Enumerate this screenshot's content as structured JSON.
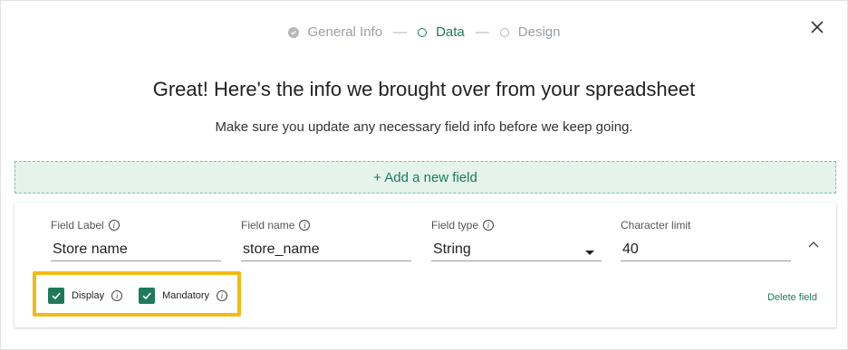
{
  "stepper": {
    "steps": [
      {
        "label": "General Info",
        "state": "done"
      },
      {
        "label": "Data",
        "state": "active"
      },
      {
        "label": "Design",
        "state": "pending"
      }
    ],
    "separator": "—"
  },
  "header": {
    "title": "Great! Here's the info we brought over from your spreadsheet",
    "subtitle": "Make sure you update any necessary field info before we keep going."
  },
  "add_field_label": "+ Add a new field",
  "field": {
    "label_title": "Field Label",
    "label_value": "Store name",
    "name_title": "Field name",
    "name_value": "store_name",
    "type_title": "Field type",
    "type_value": "String",
    "limit_title": "Character limit",
    "limit_value": "40",
    "display_label": "Display",
    "display_checked": true,
    "mandatory_label": "Mandatory",
    "mandatory_checked": true,
    "delete_label": "Delete field"
  },
  "colors": {
    "accent": "#1f7a5a",
    "highlight": "#f2bb13",
    "add_bg": "#e4f3eb"
  },
  "icons": {
    "close": "close-icon",
    "info": "info-icon",
    "collapse": "chevron-up-icon",
    "checkbox": "check-icon"
  }
}
